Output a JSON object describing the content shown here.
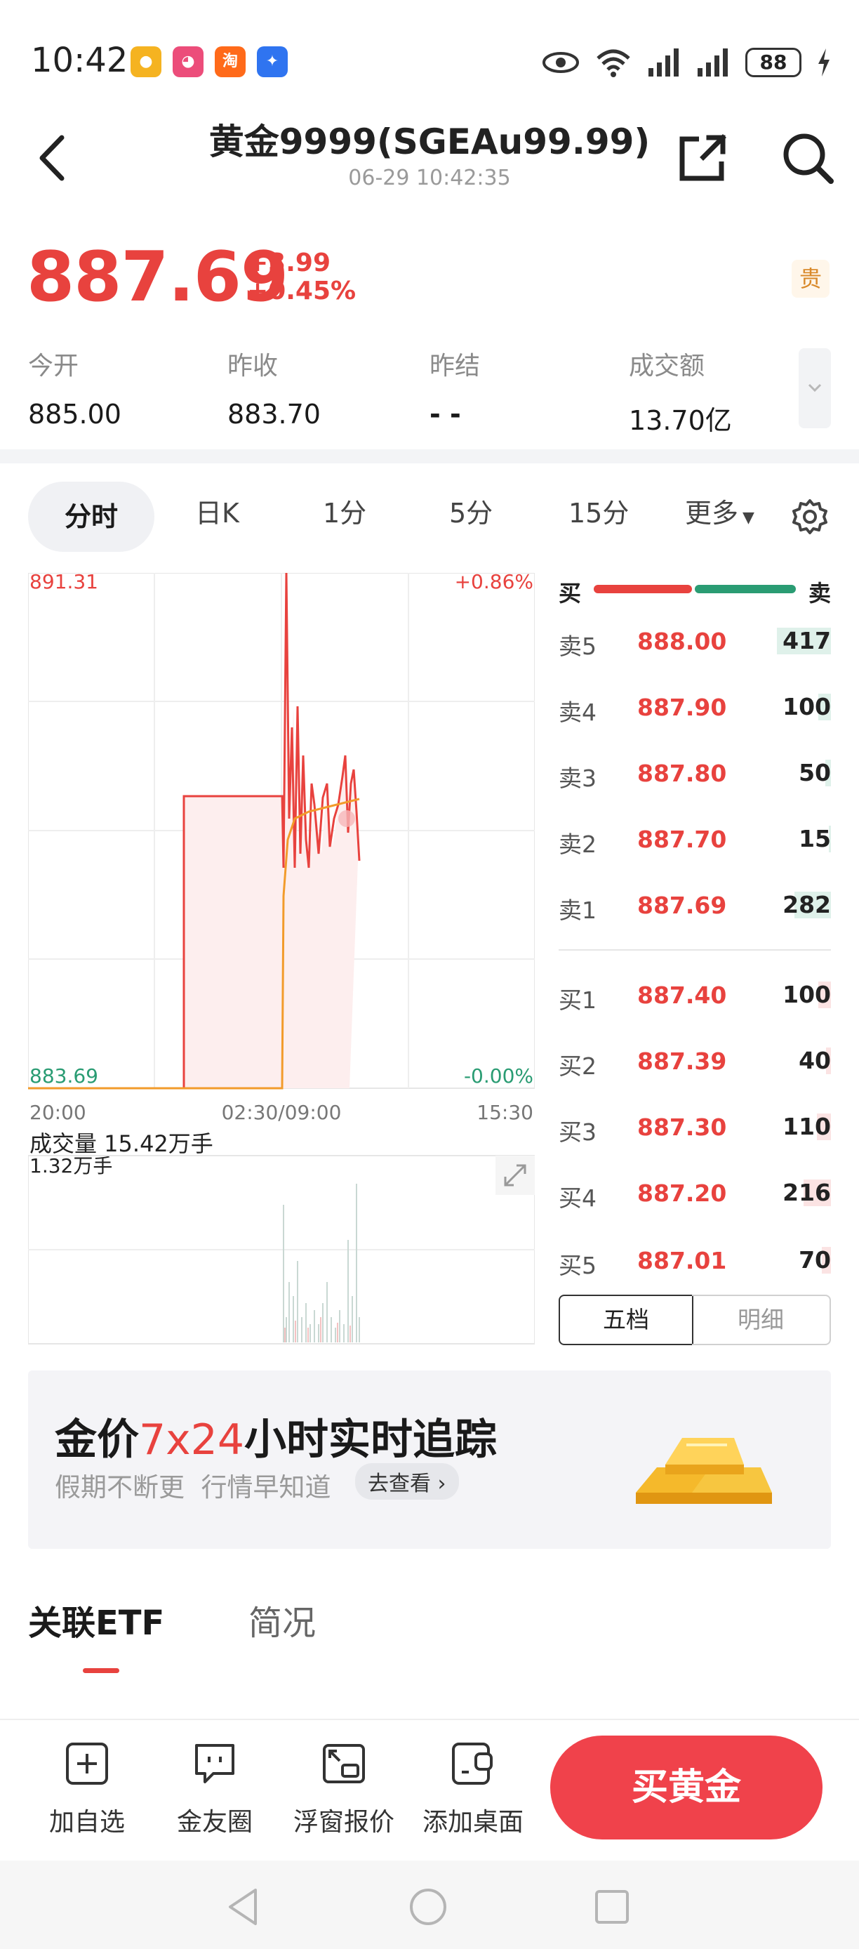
{
  "status_bar": {
    "time": "10:42",
    "apps": [
      "weibo-app-icon",
      "kids-app-icon",
      "taobao-app-icon",
      "lightbulb-app-icon"
    ],
    "taobao_char": "淘",
    "battery": "88"
  },
  "header": {
    "title": "黄金9999(SGEAu99.99)",
    "timestamp": "06-29 10:42:35"
  },
  "quote": {
    "price": "887.69",
    "change": "+3.99",
    "change_pct": "+0.45%",
    "badge": "贵"
  },
  "stats": [
    {
      "label": "今开",
      "value": "885.00"
    },
    {
      "label": "昨收",
      "value": "883.70"
    },
    {
      "label": "昨结",
      "value": "- -"
    },
    {
      "label": "成交额",
      "value": "13.70亿"
    }
  ],
  "tabs": [
    "分时",
    "日K",
    "1分",
    "5分",
    "15分",
    "更多"
  ],
  "chart": {
    "price_high": "891.31",
    "price_low": "883.69",
    "pct_high": "+0.86%",
    "pct_low": "-0.00%",
    "time_start": "20:00",
    "time_mid": "02:30/09:00",
    "time_end": "15:30",
    "volume_label": "成交量 15.42万手",
    "volume_sub": "1.32万手",
    "colors": {
      "line": "#e8423e",
      "avg": "#f29b2b",
      "volume": "#c9d8d3"
    }
  },
  "order_book": {
    "buy_label": "买",
    "sell_label": "卖",
    "asks": [
      {
        "label": "卖5",
        "price": "888.00",
        "qty": "417",
        "fill": 0.55
      },
      {
        "label": "卖4",
        "price": "887.90",
        "qty": "100",
        "fill": 0.13
      },
      {
        "label": "卖3",
        "price": "887.80",
        "qty": "50",
        "fill": 0.06
      },
      {
        "label": "卖2",
        "price": "887.70",
        "qty": "15",
        "fill": 0.02
      },
      {
        "label": "卖1",
        "price": "887.69",
        "qty": "282",
        "fill": 0.37
      }
    ],
    "bids": [
      {
        "label": "买1",
        "price": "887.40",
        "qty": "100",
        "fill": 0.13
      },
      {
        "label": "买2",
        "price": "887.39",
        "qty": "40",
        "fill": 0.05
      },
      {
        "label": "买3",
        "price": "887.30",
        "qty": "110",
        "fill": 0.14
      },
      {
        "label": "买4",
        "price": "887.20",
        "qty": "216",
        "fill": 0.28
      },
      {
        "label": "买5",
        "price": "887.01",
        "qty": "70",
        "fill": 0.09
      }
    ],
    "seg_left": "五档",
    "seg_right": "明细"
  },
  "banner": {
    "title_prefix": "金价",
    "title_highlight": "7x24",
    "title_suffix": "小时实时追踪",
    "subtitle": "假期不断更  行情早知道",
    "cta": "去查看"
  },
  "bottom_tabs": [
    "关联ETF",
    "简况"
  ],
  "toolbar": [
    {
      "label": "加自选"
    },
    {
      "label": "金友圈"
    },
    {
      "label": "浮窗报价"
    },
    {
      "label": "添加桌面"
    }
  ],
  "buy_button": "买黄金"
}
